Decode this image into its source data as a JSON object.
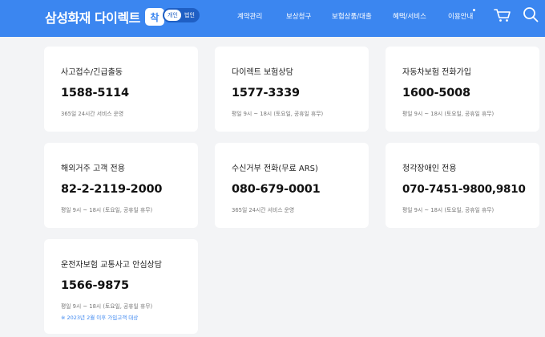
{
  "header": {
    "logo_text": "삼성화재 다이렉트",
    "logo_badge": "착",
    "toggle": {
      "personal": "개인",
      "corporate": "법인"
    },
    "nav": [
      "계약관리",
      "보상청구",
      "보험상품/대출",
      "혜택/서비스",
      "이용안내"
    ],
    "cart_icon": "cart-icon",
    "search_icon": "search-icon",
    "brand_color": "#3b86f0"
  },
  "cards": [
    {
      "title": "사고접수/긴급출동",
      "phone": "1588-5114",
      "hours": "365일 24시간 서비스 운영"
    },
    {
      "title": "다이렉트 보험상담",
      "phone": "1577-3339",
      "hours": "평일 9시 ~ 18시 (토요일, 공휴일 휴무)"
    },
    {
      "title": "자동차보험 전화가입",
      "phone": "1600-5008",
      "hours": "평일 9시 ~ 18시 (토요일, 공휴일 휴무)"
    },
    {
      "title": "해외거주 고객 전용",
      "phone": "82-2-2119-2000",
      "hours": "평일 9시 ~ 18시 (토요일, 공휴일 휴무)"
    },
    {
      "title": "수신거부 전화(무료 ARS)",
      "phone": "080-679-0001",
      "hours": "365일 24시간 서비스 운영"
    },
    {
      "title": "청각장애인 전용",
      "phone": "070-7451-9800,9810",
      "hours": "평일 9시 ~ 18시 (토요일, 공휴일 휴무)"
    },
    {
      "title": "운전자보험 교통사고 안심상담",
      "phone": "1566-9875",
      "hours": "평일 9시 ~ 18시 (토요일, 공휴일 휴무)",
      "note": "※ 2023년 2월 이후 가입고객 대상"
    }
  ]
}
